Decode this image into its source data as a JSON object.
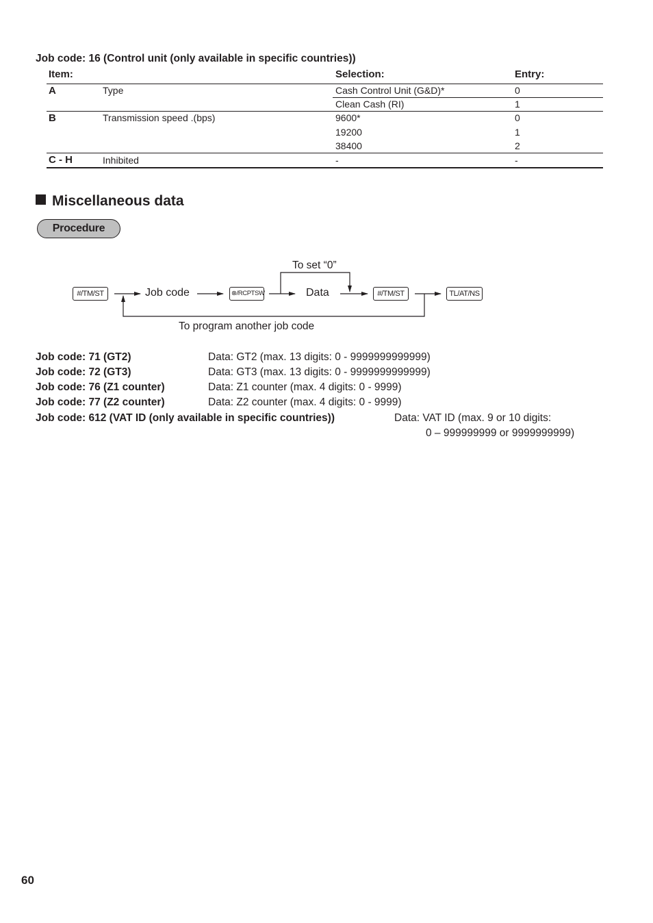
{
  "job16": {
    "title": "Job code: 16 (Control unit (only available in specific countries))",
    "headers": {
      "item": "Item:",
      "selection": "Selection:",
      "entry": "Entry:"
    },
    "rows": [
      {
        "item": "A",
        "description": "Type",
        "options": [
          {
            "selection": "Cash Control Unit (G&D)*",
            "entry": "0"
          },
          {
            "selection": "Clean Cash (RI)",
            "entry": "1"
          }
        ]
      },
      {
        "item": "B",
        "description": "Transmission speed .(bps)",
        "options": [
          {
            "selection": "9600*",
            "entry": "0"
          },
          {
            "selection": "19200",
            "entry": "1"
          },
          {
            "selection": "38400",
            "entry": "2"
          }
        ]
      },
      {
        "item": "C - H",
        "description": "Inhibited",
        "options": [
          {
            "selection": "-",
            "entry": "-"
          }
        ]
      }
    ]
  },
  "section": {
    "title": "Miscellaneous data",
    "procedure_label": "Procedure"
  },
  "diagram": {
    "key_start": "#/TM/ST",
    "step_job_code": "Job code",
    "key_receipt": "⊗/RCPTSW",
    "step_data": "Data",
    "key_mid": "#/TM/ST",
    "key_end": "TL/AT/NS",
    "to_set_zero": "To set “0”",
    "loop_label": "To program another job code"
  },
  "job_codes": [
    {
      "code": "Job code: 71 (GT2)",
      "data": "Data: GT2 (max. 13 digits: 0 - 9999999999999)"
    },
    {
      "code": "Job code: 72 (GT3)",
      "data": "Data: GT3 (max. 13 digits: 0 - 9999999999999)"
    },
    {
      "code": "Job code: 76 (Z1 counter)",
      "data": "Data: Z1 counter (max. 4 digits: 0 - 9999)"
    },
    {
      "code": "Job code: 77 (Z2 counter)",
      "data": "Data: Z2 counter (max. 4 digits: 0 - 9999)"
    },
    {
      "code": "Job code: 612 (VAT ID (only available in specific countries))",
      "data": "Data: VAT ID (max. 9 or 10 digits:",
      "data_cont": "0 – 999999999 or 9999999999)"
    }
  ],
  "page_number": "60"
}
